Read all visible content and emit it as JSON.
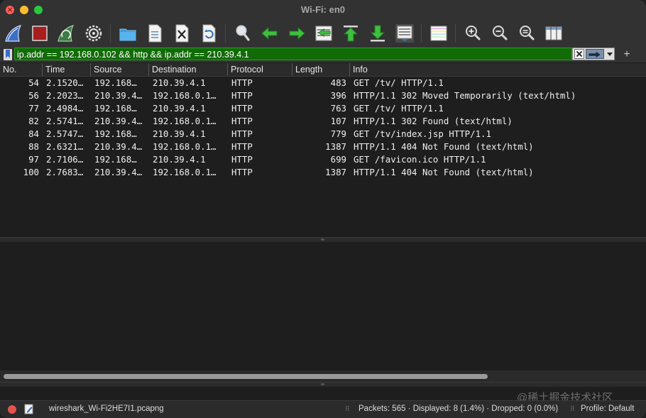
{
  "window": {
    "title": "Wi-Fi: en0",
    "close_glyph": "×"
  },
  "toolbar": {
    "icons": [
      "shark-fin-start-icon",
      "stop-square-icon",
      "shark-fin-restart-icon",
      "gear-options-icon",
      "folder-open-icon",
      "file-save-icon",
      "file-close-icon",
      "reload-icon",
      "search-magnifier-icon",
      "arrow-left-icon",
      "arrow-right-icon",
      "jump-to-packet-icon",
      "arrow-up-icon",
      "arrow-down-icon",
      "autoscroll-icon",
      "colorize-icon",
      "zoom-in-icon",
      "zoom-out-icon",
      "zoom-reset-icon",
      "resize-columns-icon"
    ]
  },
  "filter": {
    "value": "ip.addr == 192.168.0.102 && http && ip.addr == 210.39.4.1",
    "add_label": "+"
  },
  "columns": [
    "No.",
    "Time",
    "Source",
    "Destination",
    "Protocol",
    "Length",
    "Info"
  ],
  "packets": [
    {
      "no": "54",
      "time": "2.1520…",
      "src": "192.168…",
      "dst": "210.39.4.1",
      "proto": "HTTP",
      "len": "483",
      "info": "GET /tv/ HTTP/1.1"
    },
    {
      "no": "56",
      "time": "2.2023…",
      "src": "210.39.4…",
      "dst": "192.168.0.1…",
      "proto": "HTTP",
      "len": "396",
      "info": "HTTP/1.1 302 Moved Temporarily  (text/html)"
    },
    {
      "no": "77",
      "time": "2.4984…",
      "src": "192.168…",
      "dst": "210.39.4.1",
      "proto": "HTTP",
      "len": "763",
      "info": "GET /tv/ HTTP/1.1"
    },
    {
      "no": "82",
      "time": "2.5741…",
      "src": "210.39.4…",
      "dst": "192.168.0.1…",
      "proto": "HTTP",
      "len": "107",
      "info": "HTTP/1.1 302 Found  (text/html)"
    },
    {
      "no": "84",
      "time": "2.5747…",
      "src": "192.168…",
      "dst": "210.39.4.1",
      "proto": "HTTP",
      "len": "779",
      "info": "GET /tv/index.jsp HTTP/1.1"
    },
    {
      "no": "88",
      "time": "2.6321…",
      "src": "210.39.4…",
      "dst": "192.168.0.1…",
      "proto": "HTTP",
      "len": "1387",
      "info": "HTTP/1.1 404 Not Found  (text/html)"
    },
    {
      "no": "97",
      "time": "2.7106…",
      "src": "192.168…",
      "dst": "210.39.4.1",
      "proto": "HTTP",
      "len": "699",
      "info": "GET /favicon.ico HTTP/1.1"
    },
    {
      "no": "100",
      "time": "2.7683…",
      "src": "210.39.4…",
      "dst": "192.168.0.1…",
      "proto": "HTTP",
      "len": "1387",
      "info": "HTTP/1.1 404 Not Found  (text/html)"
    }
  ],
  "status": {
    "file": "wireshark_Wi-Fi2HE7I1.pcapng",
    "packets": "Packets: 565 · Displayed: 8 (1.4%) · Dropped: 0 (0.0%)",
    "profile": "Profile: Default",
    "handle": "⠿"
  },
  "watermark": "@稀土掘金技术社区",
  "colors": {
    "filter_bg": "#116b07",
    "window_bg": "#1e1e1e",
    "toolbar_bg": "#323232"
  }
}
